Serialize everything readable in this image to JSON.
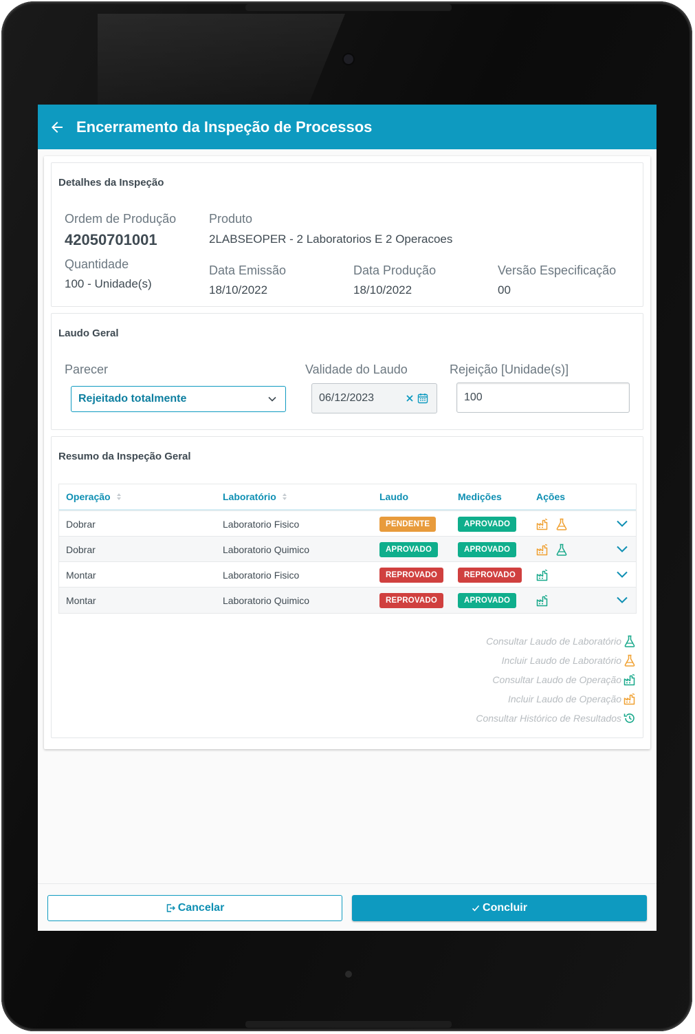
{
  "header": {
    "title": "Encerramento da Inspeção de Processos",
    "back_icon": "arrow-left-icon"
  },
  "details": {
    "title": "Detalhes da Inspeção",
    "ordem_label": "Ordem de Produção",
    "ordem_value": "42050701001",
    "produto_label": "Produto",
    "produto_value": "2LABSEOPER - 2 Laboratorios E 2 Operacoes",
    "quantidade_label": "Quantidade",
    "quantidade_value": "100 - Unidade(s)",
    "emissao_label": "Data Emissão",
    "emissao_value": "18/10/2022",
    "producao_label": "Data Produção",
    "producao_value": "18/10/2022",
    "versao_label": "Versão Especificação",
    "versao_value": "00"
  },
  "laudo": {
    "title": "Laudo Geral",
    "parecer_label": "Parecer",
    "parecer_value": "Rejeitado totalmente",
    "validade_label": "Validade do Laudo",
    "validade_value": "06/12/2023",
    "rejeicao_label": "Rejeição [Unidade(s)]",
    "rejeicao_value": "100"
  },
  "resumo": {
    "title": "Resumo da Inspeção Geral",
    "columns": [
      "Operação",
      "Laboratório",
      "Laudo",
      "Medições",
      "Ações"
    ],
    "rows": [
      {
        "operacao": "Dobrar",
        "laboratorio": "Laboratorio Fisico",
        "laudo": "PENDENTE",
        "medicoes": "APROVADO"
      },
      {
        "operacao": "Dobrar",
        "laboratorio": "Laboratorio Quimico",
        "laudo": "APROVADO",
        "medicoes": "APROVADO"
      },
      {
        "operacao": "Montar",
        "laboratorio": "Laboratorio Fisico",
        "laudo": "REPROVADO",
        "medicoes": "REPROVADO"
      },
      {
        "operacao": "Montar",
        "laboratorio": "Laboratorio Quimico",
        "laudo": "REPROVADO",
        "medicoes": "APROVADO"
      }
    ],
    "legend": [
      "Consultar Laudo de Laboratório",
      "Incluir Laudo de Laboratório",
      "Consultar Laudo de Operação",
      "Incluir Laudo de Operação",
      "Consultar Histórico de Resultados"
    ]
  },
  "footer": {
    "cancel_label": "Cancelar",
    "ok_label": "Concluir"
  },
  "colors": {
    "primary": "#0e9ac0",
    "pending": "#e89b3c",
    "approved": "#0fae8c",
    "rejected": "#d0403f",
    "action_orange": "#f0a030",
    "action_green": "#17a88a"
  }
}
